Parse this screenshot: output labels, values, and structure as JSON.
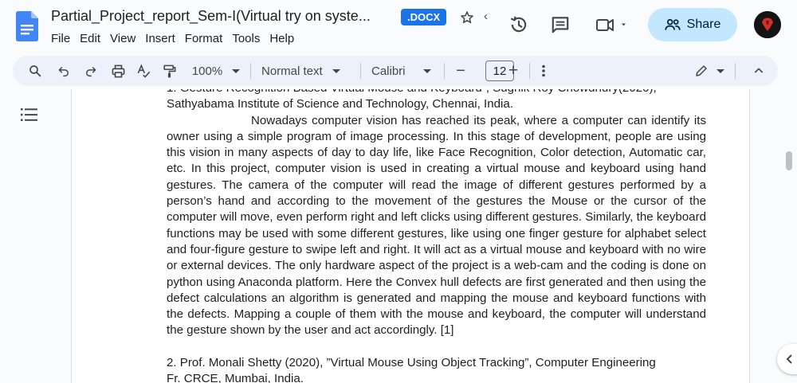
{
  "header": {
    "doc_title": "Partial_Project_report_Sem-I(Virtual try on syste...",
    "format_badge": ".DOCX",
    "share_label": "Share"
  },
  "menu": [
    "File",
    "Edit",
    "View",
    "Insert",
    "Format",
    "Tools",
    "Help"
  ],
  "toolbar": {
    "zoom": "100%",
    "style": "Normal text",
    "font": "Calibri",
    "font_size": "12",
    "minus": "−",
    "plus": "+"
  },
  "document": {
    "ref1_line1": "1.  Gesture Recognition Based Virtual Mouse and Keyboard”, Sugnik Roy Chowdhury(2020),",
    "ref1_line2": "Sathyabama Institute of Science and Technology, Chennai, India.",
    "paragraph": "Nowadays computer vision has reached its peak, where a computer can identify its owner using a simple program of image processing. In this stage of development, people are using this vision in many aspects of day to day life, like Face Recognition, Color detection, Automatic car, etc. In this project, computer vision is used in creating a virtual mouse and keyboard using hand gestures. The camera of the computer will read the image of different gestures performed by a person’s hand and according to the movement of the gestures the Mouse or the cursor of the computer will move, even perform right and left clicks using different gestures. Similarly, the keyboard functions may be used with some different gestures, like using one finger gesture for alphabet select and four-figure gesture to swipe left and right. It will act as a virtual mouse and keyboard with no wire or external devices. The only hardware aspect of the project is a web-cam and the coding is done on python using Anaconda platform. Here the Convex hull defects are first generated and then using the defect calculations an algorithm is generated and mapping the mouse and keyboard functions with the defects. Mapping a couple of them with the mouse and keyboard, the computer will understand the gesture shown by the user and act accordingly. [1]",
    "ref2_line1": "2.  Prof. Monali Shetty (2020), ”Virtual Mouse Using Object Tracking”, Computer Engineering",
    "ref2_line2": " Fr. CRCE, Mumbai, India."
  },
  "colors": {
    "share_bg": "#c2e7ff",
    "badge_bg": "#1a73e8",
    "toolbar_bg": "#edf2fa",
    "docs_blue": "#4285f4"
  }
}
